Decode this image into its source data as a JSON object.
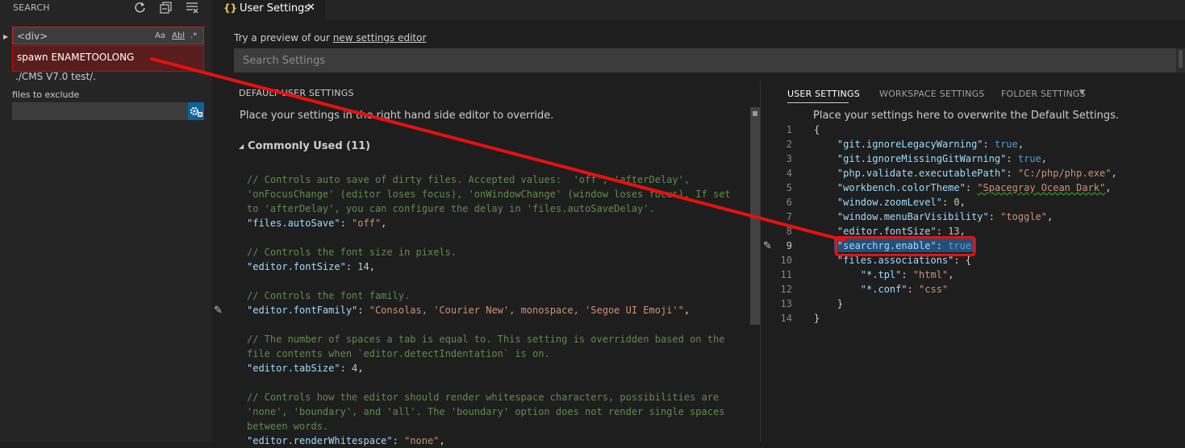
{
  "sidebar": {
    "title": "SEARCH",
    "actions": [
      {
        "name": "refresh-icon"
      },
      {
        "name": "collapse-all-icon"
      },
      {
        "name": "clear-results-icon"
      }
    ],
    "search": {
      "value": "<div>",
      "options": [
        "Aa",
        "Abl",
        ".*"
      ]
    },
    "error_message": "spawn ENAMETOOLONG",
    "include_path": "./CMS V7.0 test/.",
    "exclude_label": "files to exclude"
  },
  "tab": {
    "icon": "{}",
    "title": "User Settings",
    "close": "✕"
  },
  "preview": {
    "prefix": "Try a preview of our ",
    "link": "new settings editor"
  },
  "settings_search": {
    "placeholder": "Search Settings"
  },
  "default_pane": {
    "label": "DEFAULT USER SETTINGS",
    "description": "Place your settings in the right hand side editor to override.",
    "section": "Commonly Used (11)",
    "lines": [
      {
        "text": "// Controls auto save of dirty files. Accepted values:  'off', 'afterDelay',"
      },
      {
        "text": "'onFocusChange' (editor loses focus), 'onWindowChange' (window loses focus). If set"
      },
      {
        "text": "to 'afterDelay', you can configure the delay in 'files.autoSaveDelay'."
      },
      {
        "key": "\"files.autoSave\"",
        "sep": ": ",
        "val": "\"off\"",
        "end": ","
      },
      {
        "text": "// Controls the font size in pixels."
      },
      {
        "key": "\"editor.fontSize\"",
        "sep": ": ",
        "val": "14",
        "end": ","
      },
      {
        "text": "// Controls the font family."
      },
      {
        "key": "\"editor.fontFamily\"",
        "sep": ": ",
        "val": "\"Consolas, 'Courier New', monospace, 'Segoe UI Emoji'\"",
        "end": ","
      },
      {
        "text": "// The number of spaces a tab is equal to. This setting is overridden based on the"
      },
      {
        "text": "file contents when `editor.detectIndentation` is on."
      },
      {
        "key": "\"editor.tabSize\"",
        "sep": ": ",
        "val": "4",
        "end": ","
      },
      {
        "text": "// Controls how the editor should render whitespace characters, possibilities are"
      },
      {
        "text": "'none', 'boundary', and 'all'. The 'boundary' option does not render single spaces"
      },
      {
        "text": "between words."
      },
      {
        "key": "\"editor.renderWhitespace\"",
        "sep": ": ",
        "val": "\"none\"",
        "end": ","
      }
    ]
  },
  "user_pane": {
    "tabs": [
      "USER SETTINGS",
      "WORKSPACE SETTINGS",
      "FOLDER SETTINGS"
    ],
    "description": "Place your settings here to overwrite the Default Settings.",
    "line_numbers": [
      "1",
      "2",
      "3",
      "4",
      "5",
      "6",
      "7",
      "8",
      "9",
      "10",
      "11",
      "12",
      "13",
      "14"
    ],
    "active_line": "9",
    "code": {
      "open": "{",
      "l2": {
        "key": "\"git.ignoreLegacyWarning\"",
        "val": "true"
      },
      "l3": {
        "key": "\"git.ignoreMissingGitWarning\"",
        "val": "true"
      },
      "l4": {
        "key": "\"php.validate.executablePath\"",
        "val": "\"C:/php/php.exe\""
      },
      "l5": {
        "key": "\"workbench.colorTheme\"",
        "val": "\"Spacegray Ocean Dark\""
      },
      "l6": {
        "key": "\"window.zoomLevel\"",
        "val": "0"
      },
      "l7": {
        "key": "\"window.menuBarVisibility\"",
        "val": "\"toggle\""
      },
      "l8": {
        "key": "\"editor.fontSize\"",
        "val": "13"
      },
      "l9": {
        "key": "\"searchrg.enable\"",
        "val": "true"
      },
      "l10": {
        "key": "\"files.associations\"",
        "val": "{"
      },
      "l11": {
        "key": "\"*.tpl\"",
        "val": "\"html\""
      },
      "l12": {
        "key": "\"*.conf\"",
        "val": "\"css\""
      },
      "l13": "}",
      "l14": "}"
    }
  },
  "colors": {
    "annotation": "#e81010",
    "error_bg": "#5a1d1d",
    "accent": "#0e639c"
  }
}
